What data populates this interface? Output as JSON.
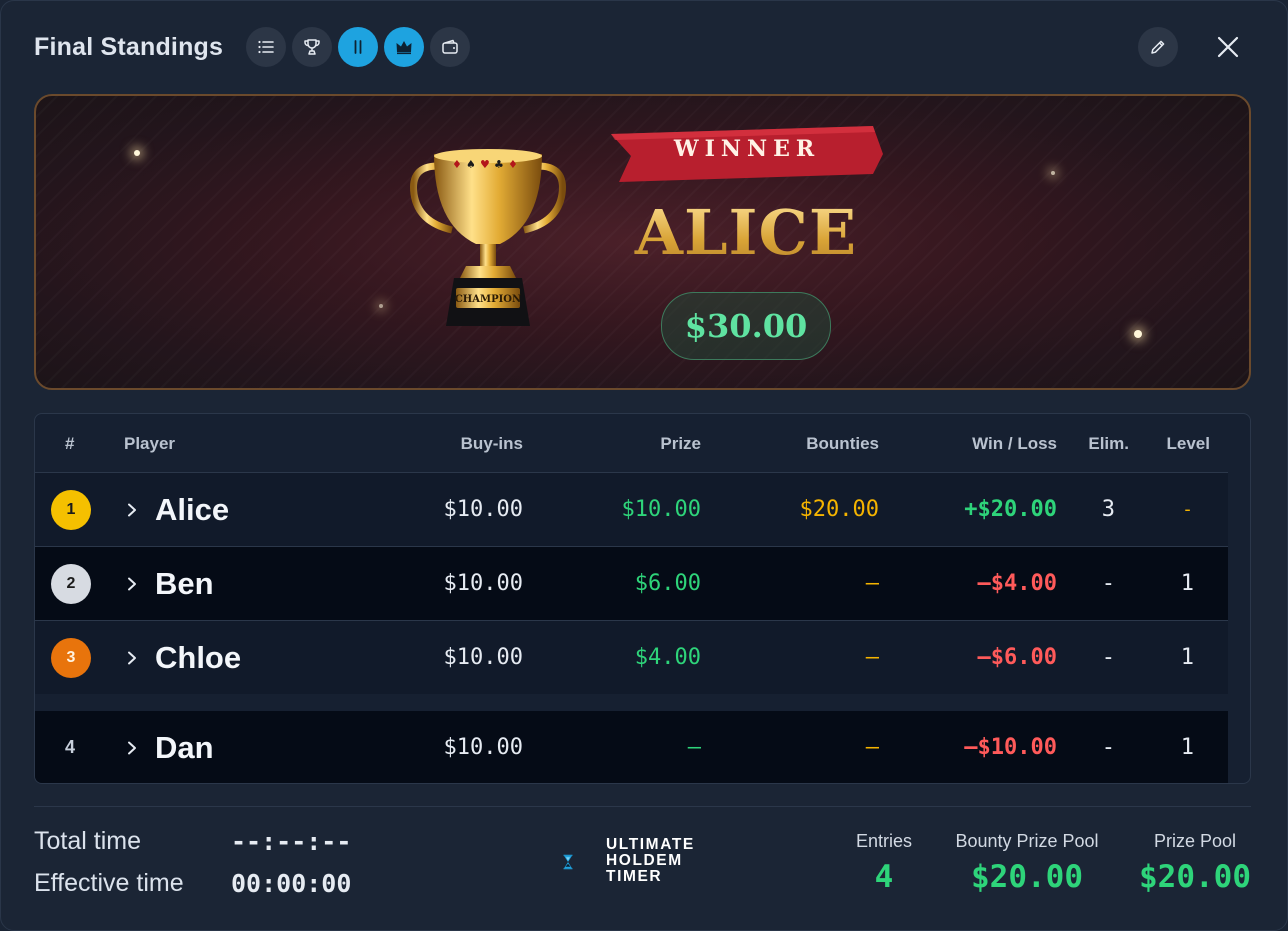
{
  "header": {
    "title": "Final Standings",
    "icons": [
      "list-icon",
      "trophy-icon",
      "pause-icon",
      "crown-icon",
      "wallet-icon",
      "edit-icon",
      "close-icon"
    ]
  },
  "banner": {
    "ribbon_text": "WINNER",
    "winner_name": "ALICE",
    "winner_prize": "$30.00",
    "trophy_plate": "CHAMPION"
  },
  "table": {
    "columns": [
      "#",
      "Player",
      "Buy-ins",
      "Prize",
      "Bounties",
      "Win / Loss",
      "Elim.",
      "Level"
    ],
    "rows": [
      {
        "rank": "1",
        "name": "Alice",
        "buyins": "$10.00",
        "prize": "$10.00",
        "bounties": "$20.00",
        "winloss": "+$20.00",
        "elim": "3",
        "level": "-"
      },
      {
        "rank": "2",
        "name": "Ben",
        "buyins": "$10.00",
        "prize": "$6.00",
        "bounties": "–",
        "winloss": "–$4.00",
        "elim": "-",
        "level": "1"
      },
      {
        "rank": "3",
        "name": "Chloe",
        "buyins": "$10.00",
        "prize": "$4.00",
        "bounties": "–",
        "winloss": "–$6.00",
        "elim": "-",
        "level": "1"
      },
      {
        "rank": "4",
        "name": "Dan",
        "buyins": "$10.00",
        "prize": "–",
        "bounties": "–",
        "winloss": "–$10.00",
        "elim": "-",
        "level": "1"
      }
    ]
  },
  "footer": {
    "total_time_label": "Total time",
    "total_time_value": "--:--:--",
    "effective_time_label": "Effective time",
    "effective_time_value": "00:00:00",
    "logo_lines": [
      "ULTIMATE",
      "HOLDEM",
      "TIMER"
    ],
    "entries_label": "Entries",
    "entries_value": "4",
    "bounty_pool_label": "Bounty Prize Pool",
    "bounty_pool_value": "$20.00",
    "prize_pool_label": "Prize Pool",
    "prize_pool_value": "$20.00"
  },
  "colors": {
    "accent": "#1ea3e0",
    "positive": "#2ed47a",
    "bounty": "#f5b400",
    "negative": "#ff5a5a",
    "gold_badge": "#f5c000",
    "silver_badge": "#d7dbe2",
    "bronze_badge": "#e8740c"
  }
}
